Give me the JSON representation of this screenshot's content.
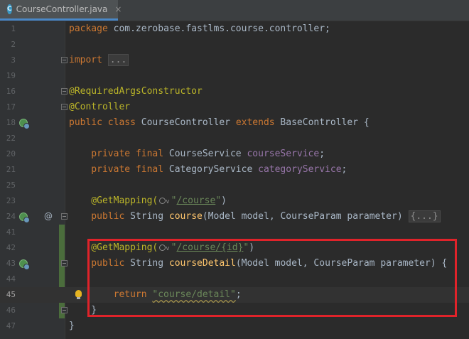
{
  "tab": {
    "icon_letter": "C",
    "filename": "CourseController.java",
    "close": "×"
  },
  "lines": {
    "l1": {
      "num": "1",
      "t1": "package",
      "t2": " com.zerobase.fastlms.course.controller;"
    },
    "l3": {
      "num": "3",
      "t1": "import",
      "t2": " ",
      "dots": "..."
    },
    "l16": {
      "num": "16",
      "t1": "@RequiredArgsConstructor"
    },
    "l17": {
      "num": "17",
      "t1": "@Controller"
    },
    "l18": {
      "num": "18",
      "t1": "public class",
      "t2": " CourseController ",
      "t3": "extends",
      "t4": " BaseController {"
    },
    "l20": {
      "num": "20",
      "t1": "    private final",
      "t2": " CourseService ",
      "t3": "courseService",
      "t4": ";"
    },
    "l21": {
      "num": "21",
      "t1": "    private final",
      "t2": " CategoryService ",
      "t3": "categoryService",
      "t4": ";"
    },
    "l23": {
      "num": "23",
      "t1": "    @GetMapping(",
      "t2": "\"",
      "link": "/course",
      "t3": "\"",
      "t4": ")"
    },
    "l24": {
      "num": "24",
      "t1": "    public",
      "t2": " String ",
      "fn": "course",
      "p1": "(Model ",
      "a1": "model",
      "p2": ", CourseParam ",
      "a2": "parameter",
      "p3": ") ",
      "dots": "{...}"
    },
    "l41": {
      "num": "41"
    },
    "l42": {
      "num": "42",
      "t1": "    @GetMapping(",
      "t2": "\"",
      "link": "/course/{id}",
      "t3": "\"",
      "t4": ")"
    },
    "l43": {
      "num": "43",
      "t1": "    public",
      "t2": " String ",
      "fn": "courseDetail",
      "p1": "(Model ",
      "a1": "model",
      "p2": ", CourseParam ",
      "a2": "parameter",
      "p3": ") {"
    },
    "l44": {
      "num": "44"
    },
    "l45": {
      "num": "45",
      "t1": "        return",
      "t2": " ",
      "s1": "\"course/detail\"",
      "t3": ";"
    },
    "l46": {
      "num": "46",
      "t1": "    }"
    },
    "l47": {
      "num": "47",
      "t1": "}"
    },
    "blank": {
      "n2": "2",
      "n19": "19",
      "n22": "22",
      "n25": "25"
    }
  },
  "colors": {
    "keyword": "#cc7832",
    "annotation": "#bbb529",
    "string": "#6a8759",
    "field": "#9876aa",
    "method": "#ffc66d",
    "highlight_box": "#e0232a"
  },
  "icons": {
    "spring_bean": "spring-bean-icon",
    "override": "at-icon",
    "intention": "lightbulb-icon",
    "url_globe": "globe-icon"
  }
}
